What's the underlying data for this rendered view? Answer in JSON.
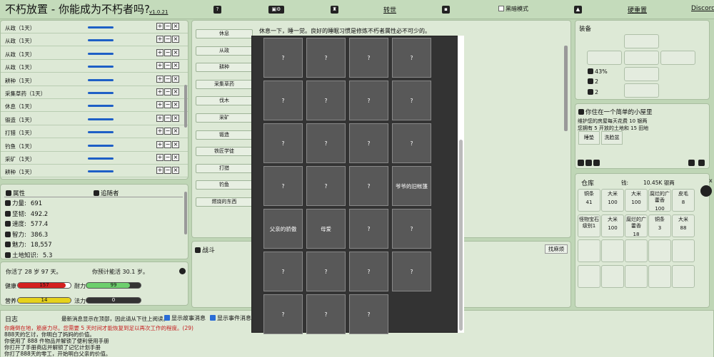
{
  "header": {
    "title": "不朽放置 - 你能成为不朽者吗?",
    "version": "v1.0.21",
    "rebirth": "转世",
    "dark_mode": "黑暗模式",
    "hard_reset": "硬重置",
    "discord": "Discord"
  },
  "activities": [
    {
      "label": "从政（1天）"
    },
    {
      "label": "从政（1天）"
    },
    {
      "label": "从政（1天）"
    },
    {
      "label": "从政（1天）"
    },
    {
      "label": "耕种（1天）"
    },
    {
      "label": "采集草药（1天）"
    },
    {
      "label": "休息（1天）"
    },
    {
      "label": "锻造（1天）"
    },
    {
      "label": "打猎（1天）"
    },
    {
      "label": "钓鱼（1天）"
    },
    {
      "label": "采矿（1天）"
    },
    {
      "label": "耕种（1天）"
    }
  ],
  "stats": {
    "title": "属性",
    "followers": "追随者",
    "items": [
      {
        "label": "力量:",
        "value": "691"
      },
      {
        "label": "坚韧:",
        "value": "492.2"
      },
      {
        "label": "速度:",
        "value": "577.4"
      },
      {
        "label": "智力:",
        "value": "386.3"
      },
      {
        "label": "魅力:",
        "value": "18,557"
      },
      {
        "label": "土地知识:",
        "value": "5.3"
      }
    ]
  },
  "life": {
    "lived": "你活了 28 岁 97 天。",
    "expected": "你预计能活 30.1 岁。",
    "health_label": "健康",
    "health_value": "157",
    "health_pct": 0.9,
    "stamina_label": "耐力",
    "stamina_value": "99",
    "stamina_pct": 0.8,
    "nutrition_label": "营养",
    "nutrition_value": "14",
    "nutrition_pct": 1.0,
    "mana_label": "法力",
    "mana_value": "0",
    "mana_pct": 0
  },
  "mid_buttons": [
    "休息",
    "从政",
    "耕种",
    "采集草药",
    "伐木",
    "采矿",
    "锻造",
    "铁匠学徒",
    "打猎",
    "钓鱼",
    "燃烧的东西"
  ],
  "mid_text": "休息一下，睡一觉。良好的睡眠习惯是修炼不朽者属性必不可少的。",
  "combat": {
    "title": "战斗",
    "find_trouble": "找麻烦"
  },
  "equipment": {
    "title": "装备",
    "stats": [
      "43%",
      "2",
      "2"
    ]
  },
  "home": {
    "title": "你住在一个简单的小屋里",
    "lines": [
      "维护您的房屋每天花费 10 银两",
      "您拥有 5 开放的土地和 15 田地"
    ],
    "items": [
      "睡垫",
      "洗脸盆"
    ]
  },
  "storage": {
    "title": "仓库",
    "money": "钱:",
    "money_value": "10.45K 银两",
    "items": [
      {
        "name": "铜条",
        "count": "41"
      },
      {
        "name": "大米",
        "count": "100"
      },
      {
        "name": "大米",
        "count": "100"
      },
      {
        "name": "腐烂的广藿香",
        "count": "100"
      },
      {
        "name": "皮毛",
        "count": "8"
      },
      {
        "name": "怪物宝石 级别1",
        "count": ""
      },
      {
        "name": "大米",
        "count": "100"
      },
      {
        "name": "腐烂的广藿香",
        "count": "18"
      },
      {
        "name": "铜条",
        "count": "3"
      },
      {
        "name": "大米",
        "count": "88"
      }
    ]
  },
  "log": {
    "title": "日志",
    "note": "最新消息显示在顶部，因此请从下往上阅读。",
    "show_story": "显示故事消息",
    "show_event": "显示事件消息",
    "lines": [
      {
        "text": "你瘫倒在地，筋疲力尽。您需要 5 天时间才能恢复到足以再次工作的程度。(29)",
        "color": "#c62020"
      },
      {
        "text": "888天的乞讨，你明白了妈妈的价值。",
        "color": "#111"
      },
      {
        "text": "你使用了 888 件物品并解锁了便利使用手册",
        "color": "#111"
      },
      {
        "text": "你打开了手册商店并解锁了记忆计划手册",
        "color": "#111"
      },
      {
        "text": "你打了888天的零工，开始明白父亲的价值。",
        "color": "#111"
      }
    ]
  },
  "close_x": "x",
  "cards": [
    "?",
    "?",
    "?",
    "?",
    "?",
    "?",
    "?",
    "?",
    "?",
    "?",
    "?",
    "?",
    "?",
    "?",
    "?",
    "爷爷的旧帐篷",
    "父亲的骄傲",
    "母爱",
    "?",
    "?",
    "?",
    "?",
    "?",
    "?",
    "?",
    "?",
    "?"
  ]
}
